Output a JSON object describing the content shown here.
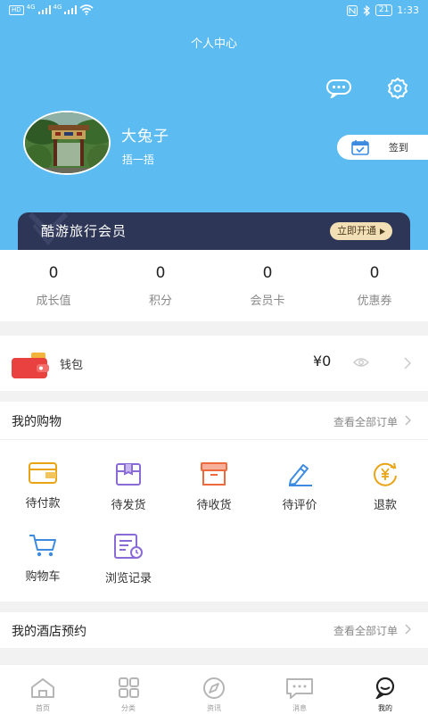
{
  "status_bar": {
    "left_tags": [
      "HD",
      "4G",
      "4G",
      "HD"
    ],
    "time": "1:33",
    "battery": "21"
  },
  "header": {
    "title": "个人中心",
    "username": "大兔子",
    "subname": "捂一捂",
    "checkin_label": "签到",
    "icons": [
      "message-icon",
      "settings-gear-icon",
      "calendar-check-icon"
    ]
  },
  "vip": {
    "title": "酷游旅行会员",
    "button": "立即开通"
  },
  "stats": [
    {
      "value": "0",
      "label": "成长值"
    },
    {
      "value": "0",
      "label": "积分"
    },
    {
      "value": "0",
      "label": "会员卡"
    },
    {
      "value": "0",
      "label": "优惠券"
    }
  ],
  "wallet": {
    "label": "钱包",
    "amount": "¥0"
  },
  "shopping": {
    "title": "我的购物",
    "view_all": "查看全部订单",
    "items": [
      {
        "label": "待付款",
        "icon": "wallet-icon"
      },
      {
        "label": "待发货",
        "icon": "box-icon"
      },
      {
        "label": "待收货",
        "icon": "inbox-icon"
      },
      {
        "label": "待评价",
        "icon": "pen-icon"
      },
      {
        "label": "退款",
        "icon": "refund-yen-icon"
      },
      {
        "label": "购物车",
        "icon": "cart-icon"
      },
      {
        "label": "浏览记录",
        "icon": "history-icon"
      }
    ]
  },
  "hotel": {
    "title": "我的酒店预约",
    "view_all": "查看全部订单"
  },
  "tabbar": [
    {
      "label": "首页",
      "icon": "home-icon",
      "active": false
    },
    {
      "label": "分类",
      "icon": "grid-icon",
      "active": false
    },
    {
      "label": "资讯",
      "icon": "compass-icon",
      "active": false
    },
    {
      "label": "消息",
      "icon": "chat-icon",
      "active": false
    },
    {
      "label": "我的",
      "icon": "profile-icon",
      "active": true
    }
  ],
  "colors": {
    "header_bg": "#5cbcf1",
    "vip_bg": "#2e3657",
    "accent_yellow": "#e8a415",
    "accent_blue": "#3d8be0",
    "accent_red": "#e94040",
    "accent_purple": "#8a6bd6"
  }
}
